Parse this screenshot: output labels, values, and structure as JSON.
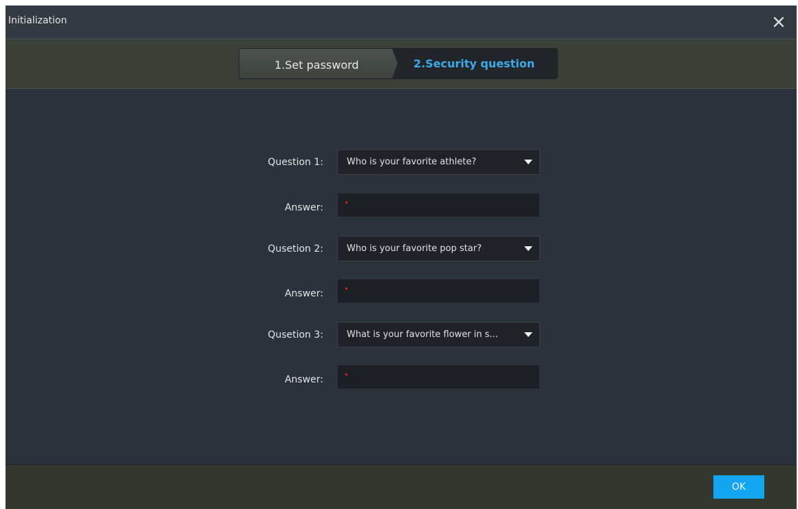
{
  "window": {
    "title": "Initialization",
    "close_icon": "close-icon"
  },
  "steps": [
    {
      "label": "1.Set password",
      "active": false
    },
    {
      "label": "2.Security question",
      "active": true
    }
  ],
  "questions": [
    {
      "label": "Question 1:",
      "value": "Who is your favorite athlete?",
      "answer_label": "Answer:",
      "answer_value": ""
    },
    {
      "label": "Qusetion 2:",
      "value": "Who is your favorite pop star?",
      "answer_label": "Answer:",
      "answer_value": ""
    },
    {
      "label": "Qusetion 3:",
      "value": "What is your favorite flower in s...",
      "answer_label": "Answer:",
      "answer_value": ""
    }
  ],
  "footer": {
    "ok_label": "OK"
  },
  "colors": {
    "accent": "#12a5f0",
    "active_step": "#3da9e8",
    "required_marker": "#ff1e1e",
    "background": "#2c323b"
  }
}
